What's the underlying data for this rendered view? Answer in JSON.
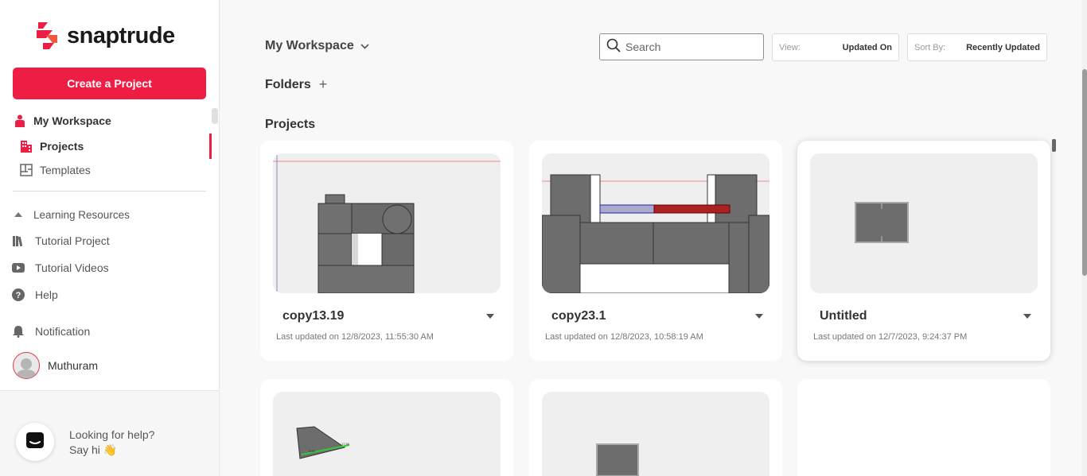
{
  "app": {
    "name": "snaptrude"
  },
  "sidebar": {
    "create_label": "Create a Project",
    "workspace_label": "My Workspace",
    "projects_label": "Projects",
    "templates_label": "Templates",
    "learning_label": "Learning Resources",
    "tutorial_project_label": "Tutorial Project",
    "tutorial_videos_label": "Tutorial Videos",
    "help_label": "Help",
    "notification_label": "Notification",
    "user_name": "Muthuram"
  },
  "help_widget": {
    "line1": "Looking for help?",
    "line2": "Say hi 👋"
  },
  "header": {
    "workspace_title": "My Workspace",
    "search_placeholder": "Search",
    "view_key": "View:",
    "view_value": "Updated On",
    "sort_key": "Sort By:",
    "sort_value": "Recently Updated"
  },
  "folders_label": "Folders",
  "folders_add": "+",
  "projects_heading": "Projects",
  "projects": [
    {
      "name": "copy13.19",
      "updated": "Last updated on 12/8/2023, 11:55:30 AM"
    },
    {
      "name": "copy23.1",
      "updated": "Last updated on 12/8/2023, 10:58:19 AM"
    },
    {
      "name": "Untitled",
      "updated": "Last updated on 12/7/2023, 9:24:37 PM"
    }
  ],
  "colors": {
    "accent": "#ee1d43"
  }
}
